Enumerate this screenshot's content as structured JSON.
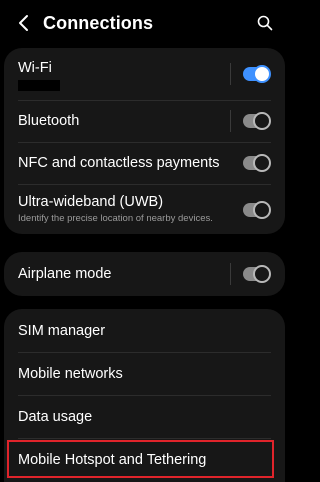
{
  "header": {
    "title": "Connections",
    "back_icon": "back-arrow-icon",
    "search_icon": "search-icon"
  },
  "network_card": {
    "wifi": {
      "label": "Wi-Fi",
      "enabled": true,
      "network_name_redacted": true
    },
    "bluetooth": {
      "label": "Bluetooth",
      "enabled": false
    },
    "nfc": {
      "label": "NFC and contactless payments",
      "enabled": false
    },
    "uwb": {
      "label": "Ultra-wideband (UWB)",
      "description": "Identify the precise location of nearby devices.",
      "enabled": false
    }
  },
  "airplane_card": {
    "airplane": {
      "label": "Airplane mode",
      "enabled": false
    }
  },
  "more_card": {
    "items": [
      {
        "label": "SIM manager"
      },
      {
        "label": "Mobile networks"
      },
      {
        "label": "Data usage"
      },
      {
        "label": "Mobile Hotspot and Tethering"
      }
    ]
  },
  "colors": {
    "accent": "#3e91ff",
    "card_background": "#171717",
    "page_background": "#000000",
    "highlight_border": "#e0242b"
  }
}
